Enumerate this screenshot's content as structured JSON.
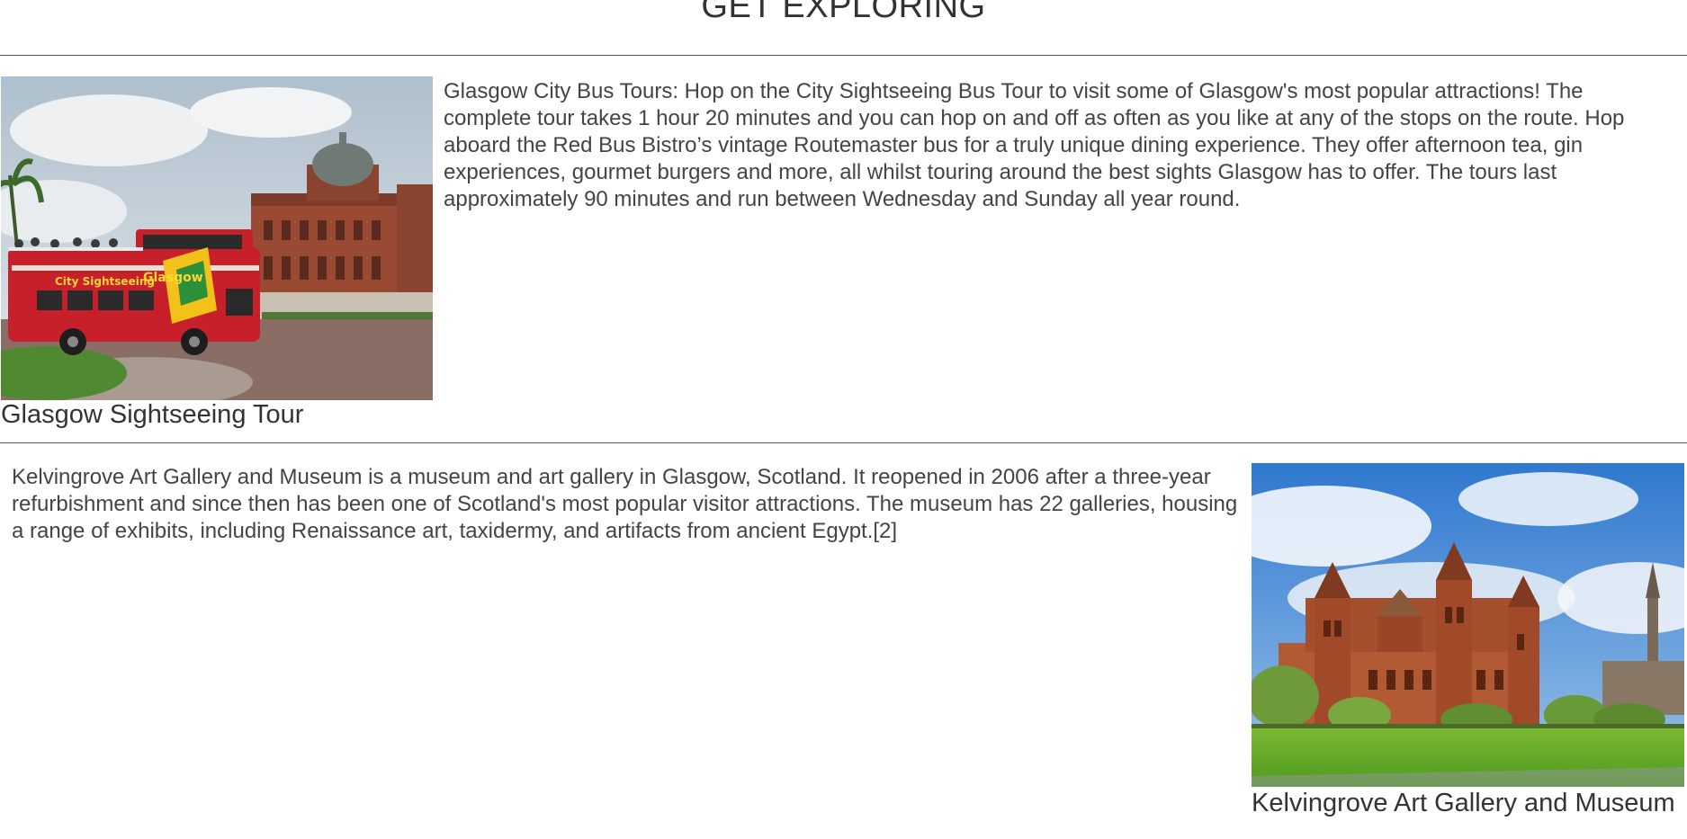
{
  "page": {
    "title": "GET EXPLORING"
  },
  "attractions": [
    {
      "caption": "Glasgow Sightseeing Tour",
      "image_subject": "red open-top City Sightseeing Glasgow bus in front of red sandstone palace",
      "description": "Glasgow City Bus Tours: Hop on the City Sightseeing Bus Tour to visit some of Glasgow's most popular attractions! The complete tour takes 1 hour 20 minutes and you can hop on and off as often as you like at any of the stops on the route. Hop aboard the Red Bus Bistro’s vintage Routemaster bus for a truly unique dining experience. They offer afternoon tea, gin experiences, gourmet burgers and more, all whilst touring around the best sights Glasgow has to offer. The tours last approximately 90 minutes and run between Wednesday and Sunday all year round."
    },
    {
      "caption": "Kelvingrove Art Gallery and Museum",
      "image_subject": "red sandstone Kelvingrove Art Gallery building behind green lawn under blue sky",
      "description": "Kelvingrove Art Gallery and Museum is a museum and art gallery in Glasgow, Scotland. It reopened in 2006 after a three-year refurbishment and since then has been one of Scotland's most popular visitor attractions. The museum has 22 galleries, housing a range of exhibits, including Renaissance art, taxidermy, and artifacts from ancient Egypt.[2]"
    }
  ],
  "colors": {
    "text": "#333333",
    "rule": "#555555",
    "bus_red": "#c8202a",
    "sandstone": "#a0503a",
    "lawn": "#6aa52a",
    "sky": "#3f86d4"
  }
}
